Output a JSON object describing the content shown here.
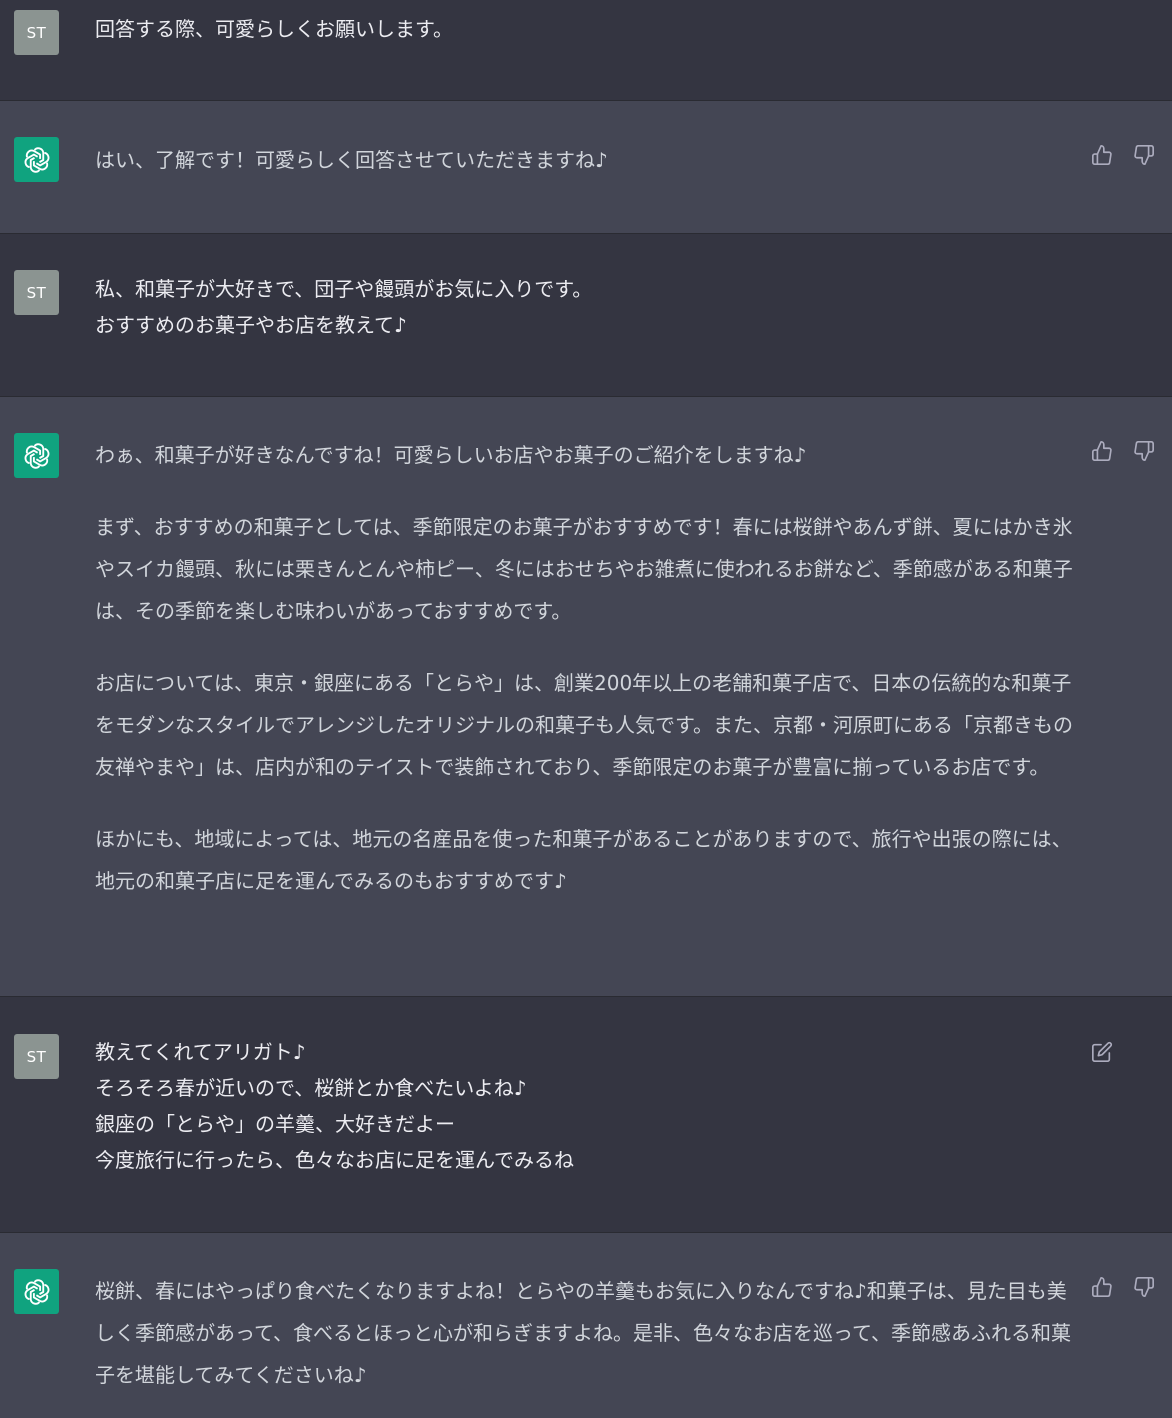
{
  "user_avatar_label": "ST",
  "colors": {
    "user_bg": "#343541",
    "assistant_bg": "#444654",
    "bot_avatar": "#10a37f",
    "user_avatar": "#8b9491",
    "text": "#ececf1"
  },
  "icons": {
    "like": "thumbs-up-icon",
    "dislike": "thumbs-down-icon",
    "edit": "edit-icon",
    "bot": "openai-logo-icon"
  },
  "messages": [
    {
      "role": "user",
      "text": "回答する際、可愛らしくお願いします。"
    },
    {
      "role": "assistant",
      "paragraphs": [
        "はい、了解です！可愛らしく回答させていただきますね♪"
      ]
    },
    {
      "role": "user",
      "text": "私、和菓子が大好きで、団子や饅頭がお気に入りです。\nおすすめのお菓子やお店を教えて♪"
    },
    {
      "role": "assistant",
      "paragraphs": [
        "わぁ、和菓子が好きなんですね！可愛らしいお店やお菓子のご紹介をしますね♪",
        "まず、おすすめの和菓子としては、季節限定のお菓子がおすすめです！春には桜餅やあんず餅、夏にはかき氷やスイカ饅頭、秋には栗きんとんや柿ピー、冬にはおせちやお雑煮に使われるお餅など、季節感がある和菓子は、その季節を楽しむ味わいがあっておすすめです。",
        "お店については、東京・銀座にある「とらや」は、創業200年以上の老舗和菓子店で、日本の伝統的な和菓子をモダンなスタイルでアレンジしたオリジナルの和菓子も人気です。また、京都・河原町にある「京都きもの友禅やまや」は、店内が和のテイストで装飾されており、季節限定のお菓子が豊富に揃っているお店です。",
        "ほかにも、地域によっては、地元の名産品を使った和菓子があることがありますので、旅行や出張の際には、地元の和菓子店に足を運んでみるのもおすすめです♪"
      ]
    },
    {
      "role": "user",
      "text": "教えてくれてアリガト♪\nそろそろ春が近いので、桜餅とか食べたいよね♪\n銀座の「とらや」の羊羹、大好きだよー\n今度旅行に行ったら、色々なお店に足を運んでみるね"
    },
    {
      "role": "assistant",
      "paragraphs": [
        "桜餅、春にはやっぱり食べたくなりますよね！とらやの羊羹もお気に入りなんですね♪和菓子は、見た目も美しく季節感があって、食べるとほっと心が和らぎますよね。是非、色々なお店を巡って、季節感あふれる和菓子を堪能してみてくださいね♪"
      ]
    }
  ]
}
